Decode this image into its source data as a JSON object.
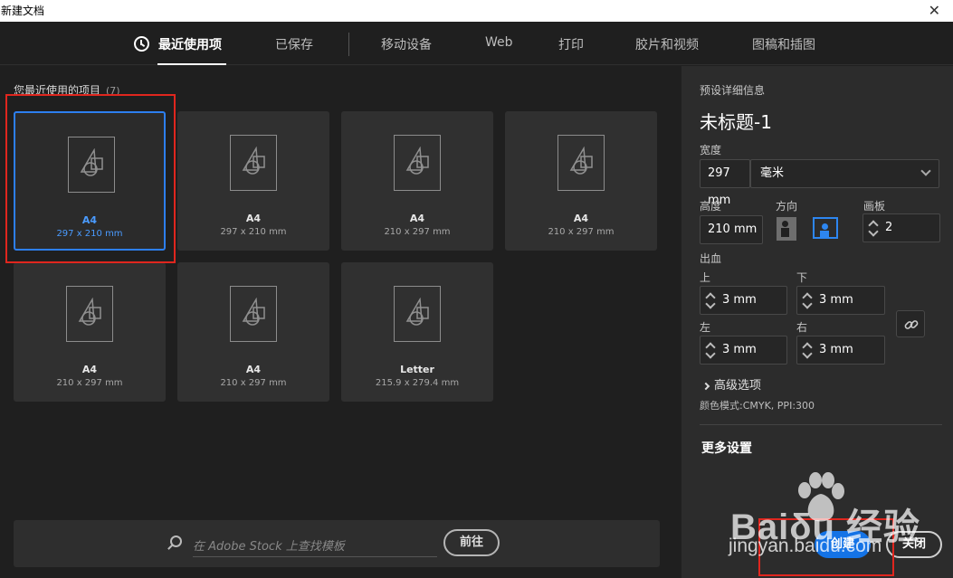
{
  "window": {
    "title": "新建文档",
    "close_glyph": "✕"
  },
  "tabs": [
    {
      "label": "最近使用项",
      "active": true
    },
    {
      "label": "已保存"
    },
    {
      "label": "移动设备"
    },
    {
      "label": "Web"
    },
    {
      "label": "打印"
    },
    {
      "label": "胶片和视频"
    },
    {
      "label": "图稿和插图"
    }
  ],
  "recent": {
    "label": "您最近使用的项目",
    "count": "(7)",
    "items": [
      {
        "name": "A4",
        "size": "297 x 210 mm",
        "selected": true
      },
      {
        "name": "A4",
        "size": "297 x 210 mm"
      },
      {
        "name": "A4",
        "size": "210 x 297 mm"
      },
      {
        "name": "A4",
        "size": "210 x 297 mm"
      },
      {
        "name": "A4",
        "size": "210 x 297 mm"
      },
      {
        "name": "A4",
        "size": "210 x 297 mm"
      },
      {
        "name": "Letter",
        "size": "215.9 x 279.4 mm"
      }
    ]
  },
  "search": {
    "placeholder": "在 Adobe Stock 上查找模板",
    "go_label": "前往"
  },
  "details": {
    "header": "预设详细信息",
    "doc_title": "未标题-1",
    "width_label": "宽度",
    "width_value": "297 mm",
    "unit_value": "毫米",
    "height_label": "高度",
    "height_value": "210 mm",
    "orientation_label": "方向",
    "orientation_selected": "landscape",
    "artboards_label": "画板",
    "artboards_value": "2",
    "bleed_label": "出血",
    "bleed_top_label": "上",
    "bleed_top_value": "3 mm",
    "bleed_bottom_label": "下",
    "bleed_bottom_value": "3 mm",
    "bleed_left_label": "左",
    "bleed_left_value": "3 mm",
    "bleed_right_label": "右",
    "bleed_right_value": "3 mm",
    "advanced_label": "高级选项",
    "color_mode": "颜色模式:CMYK, PPI:300",
    "more_settings": "更多设置"
  },
  "actions": {
    "create_label": "创建",
    "close_label": "关闭"
  },
  "watermark": {
    "brand": "Baiδu 经验",
    "url": "jingyan.baidu.com"
  },
  "colors": {
    "accent": "#1473e6",
    "selection": "#2d7ff0",
    "annotation_red": "#e0261e"
  }
}
